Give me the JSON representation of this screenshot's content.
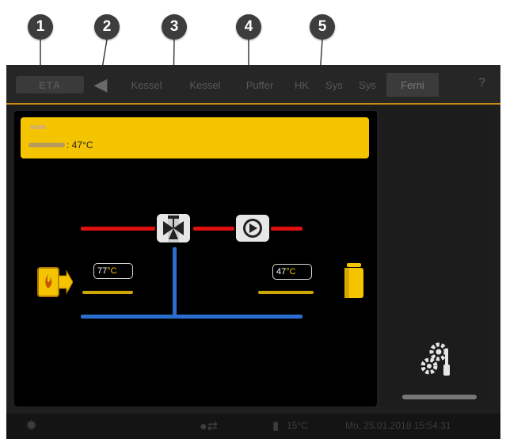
{
  "callouts": [
    "1",
    "2",
    "3",
    "4",
    "5"
  ],
  "header": {
    "logo": "ETA",
    "tabs": [
      "Kessel",
      "Kessel",
      "Puffer",
      "HK",
      "Sys",
      "Sys",
      "Ferni"
    ],
    "active_tab": "Ferni",
    "help": "?"
  },
  "banner": {
    "value": ": 47°C"
  },
  "diagram": {
    "left_temp": "77",
    "right_temp": "47",
    "unit": "°C"
  },
  "status": {
    "outdoor_temp": "15°C",
    "datetime": "Mo, 25.01.2018 15:54:31"
  },
  "colors": {
    "accent": "#f5c400",
    "supply": "#e01010",
    "return": "#2a6fd0",
    "tab_border": "#c68a12"
  }
}
